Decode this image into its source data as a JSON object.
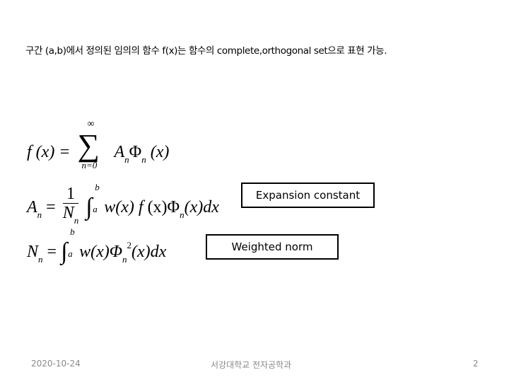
{
  "slide": {
    "intro_text": "구간 (a,b)에서 정의된 임의의 함수 f(x)는 함수의 complete,orthogonal set으로 표현 가능.",
    "equations": {
      "expansion": {
        "lhs": "f (x) =",
        "sum_upper": "∞",
        "sum_lower": "n=0",
        "term_A": "A",
        "term_sub": "n",
        "term_phi": "Φ",
        "term_phi_sub": "n",
        "term_arg": "(x)"
      },
      "coefficient": {
        "lhs": "A",
        "lhs_sub": "n",
        "equals": "=",
        "frac_num": "1",
        "frac_den": "N",
        "frac_den_sub": "n",
        "int_upper": "b",
        "int_lower": "a",
        "integrand_1": "w(x) ",
        "integrand_f": "f",
        "integrand_2": " (x)Φ",
        "integrand_sub": "n",
        "integrand_3": "(x)dx"
      },
      "norm": {
        "lhs": "N",
        "lhs_sub": "n",
        "equals": "=",
        "int_upper": "b",
        "int_lower": "a",
        "integrand_1": "w(x)Φ",
        "integrand_sub": "n",
        "integrand_sup": "2",
        "integrand_2": "(x)dx"
      }
    },
    "labels": {
      "expansion_constant": "Expansion constant",
      "weighted_norm": "Weighted norm"
    }
  },
  "footer": {
    "date": "2020-10-24",
    "organization": "서강대학교 전자공학과",
    "page_number": "2"
  }
}
